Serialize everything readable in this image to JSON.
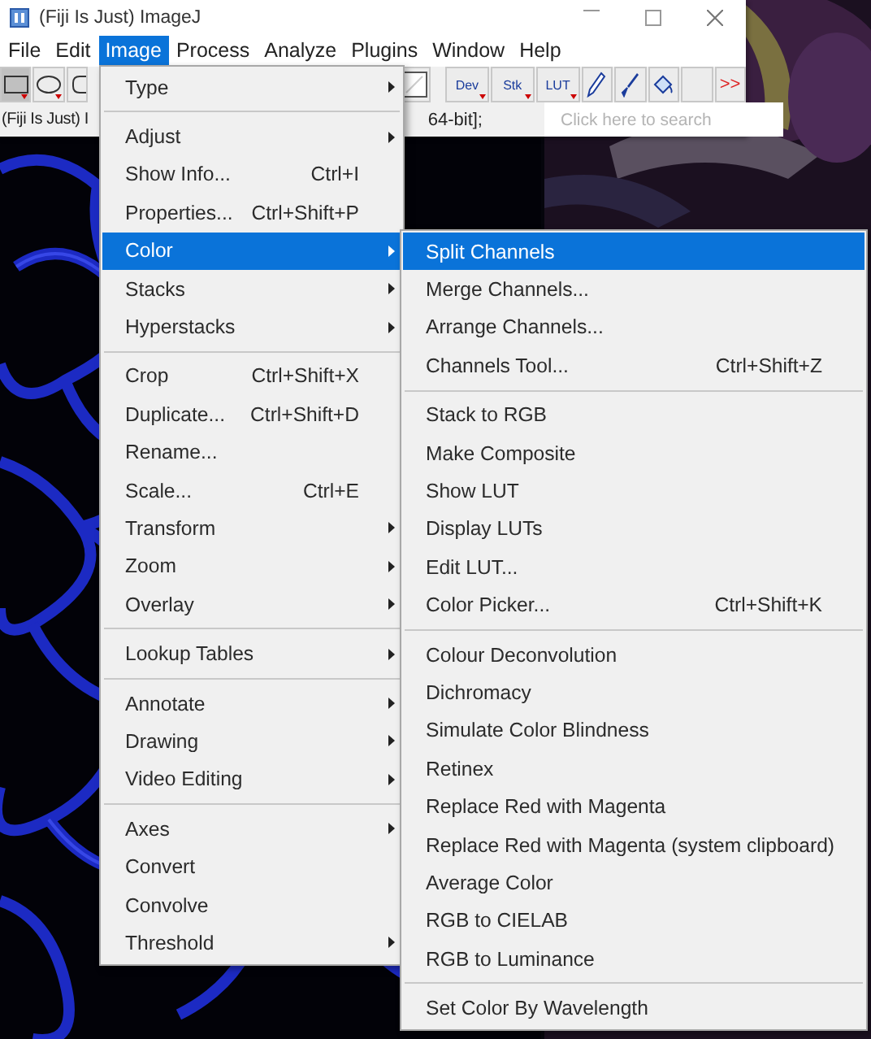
{
  "window": {
    "title": "(Fiji Is Just) ImageJ"
  },
  "menubar": [
    {
      "label": "File",
      "selected": false
    },
    {
      "label": "Edit",
      "selected": false
    },
    {
      "label": "Image",
      "selected": true
    },
    {
      "label": "Process",
      "selected": false
    },
    {
      "label": "Analyze",
      "selected": false
    },
    {
      "label": "Plugins",
      "selected": false
    },
    {
      "label": "Window",
      "selected": false
    },
    {
      "label": "Help",
      "selected": false
    }
  ],
  "toolbar": {
    "buttons": [
      "Dev",
      "Stk",
      "LUT"
    ],
    "more": ">>"
  },
  "status": {
    "texts": [
      "(Fiji Is Just) I",
      "64-bit];"
    ],
    "search": {
      "placeholder": "Click here to search"
    }
  },
  "menu": [
    {
      "kind": "item",
      "label": "Type",
      "submenu": true,
      "selected": false
    },
    {
      "kind": "separator"
    },
    {
      "kind": "item",
      "label": "Adjust",
      "submenu": true,
      "selected": false
    },
    {
      "kind": "item",
      "label": "Show Info...",
      "shortcut": "Ctrl+I",
      "selected": false
    },
    {
      "kind": "item",
      "label": "Properties...",
      "shortcut": "Ctrl+Shift+P",
      "selected": false
    },
    {
      "kind": "item",
      "label": "Color",
      "submenu": true,
      "selected": true
    },
    {
      "kind": "item",
      "label": "Stacks",
      "submenu": true,
      "selected": false
    },
    {
      "kind": "item",
      "label": "Hyperstacks",
      "submenu": true,
      "selected": false
    },
    {
      "kind": "separator"
    },
    {
      "kind": "item",
      "label": "Crop",
      "shortcut": "Ctrl+Shift+X",
      "selected": false
    },
    {
      "kind": "item",
      "label": "Duplicate...",
      "shortcut": "Ctrl+Shift+D",
      "selected": false
    },
    {
      "kind": "item",
      "label": "Rename...",
      "selected": false
    },
    {
      "kind": "item",
      "label": "Scale...",
      "shortcut": "Ctrl+E",
      "selected": false
    },
    {
      "kind": "item",
      "label": "Transform",
      "submenu": true,
      "selected": false
    },
    {
      "kind": "item",
      "label": "Zoom",
      "submenu": true,
      "selected": false
    },
    {
      "kind": "item",
      "label": "Overlay",
      "submenu": true,
      "selected": false
    },
    {
      "kind": "separator"
    },
    {
      "kind": "item",
      "label": "Lookup Tables",
      "submenu": true,
      "selected": false
    },
    {
      "kind": "separator"
    },
    {
      "kind": "item",
      "label": "Annotate",
      "submenu": true,
      "selected": false
    },
    {
      "kind": "item",
      "label": "Drawing",
      "submenu": true,
      "selected": false
    },
    {
      "kind": "item",
      "label": "Video Editing",
      "submenu": true,
      "selected": false
    },
    {
      "kind": "separator"
    },
    {
      "kind": "item",
      "label": "Axes",
      "submenu": true,
      "selected": false
    },
    {
      "kind": "item",
      "label": "Convert",
      "selected": false
    },
    {
      "kind": "item",
      "label": "Convolve",
      "selected": false
    },
    {
      "kind": "item",
      "label": "Threshold",
      "submenu": true,
      "selected": false
    }
  ],
  "submenu": [
    {
      "kind": "item",
      "label": "Split Channels",
      "selected": true
    },
    {
      "kind": "item",
      "label": "Merge Channels...",
      "selected": false
    },
    {
      "kind": "item",
      "label": "Arrange Channels...",
      "selected": false
    },
    {
      "kind": "item",
      "label": "Channels Tool...",
      "shortcut": "Ctrl+Shift+Z",
      "selected": false
    },
    {
      "kind": "separator"
    },
    {
      "kind": "item",
      "label": "Stack to RGB",
      "selected": false
    },
    {
      "kind": "item",
      "label": "Make Composite",
      "selected": false
    },
    {
      "kind": "item",
      "label": "Show LUT",
      "selected": false
    },
    {
      "kind": "item",
      "label": "Display LUTs",
      "selected": false
    },
    {
      "kind": "item",
      "label": "Edit LUT...",
      "selected": false
    },
    {
      "kind": "item",
      "label": "Color Picker...",
      "shortcut": "Ctrl+Shift+K",
      "selected": false
    },
    {
      "kind": "separator"
    },
    {
      "kind": "item",
      "label": "Colour Deconvolution",
      "selected": false
    },
    {
      "kind": "item",
      "label": "Dichromacy",
      "selected": false
    },
    {
      "kind": "item",
      "label": "Simulate Color Blindness",
      "selected": false
    },
    {
      "kind": "item",
      "label": "Retinex",
      "selected": false
    },
    {
      "kind": "item",
      "label": "Replace Red with Magenta",
      "selected": false
    },
    {
      "kind": "item",
      "label": "Replace Red with Magenta (system clipboard)",
      "selected": false
    },
    {
      "kind": "item",
      "label": "Average Color",
      "selected": false
    },
    {
      "kind": "item",
      "label": "RGB to CIELAB",
      "selected": false
    },
    {
      "kind": "item",
      "label": "RGB to Luminance",
      "selected": false
    },
    {
      "kind": "separator"
    },
    {
      "kind": "item",
      "label": "Set Color By Wavelength",
      "selected": false
    }
  ]
}
